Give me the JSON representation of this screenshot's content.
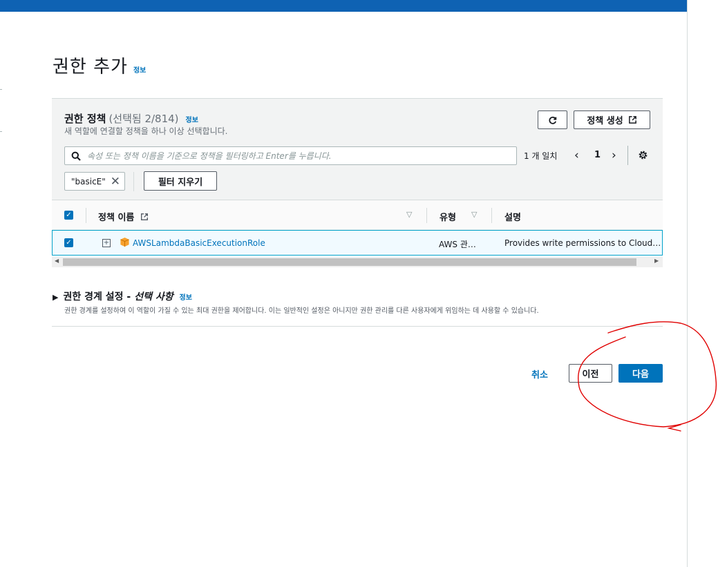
{
  "page": {
    "title": "권한 추가",
    "info_label": "정보"
  },
  "policies_panel": {
    "title": "권한 정책",
    "selection_count": "(선택됨 2/814)",
    "info_label": "정보",
    "description": "새 역할에 연결할 정책을 하나 이상 선택합니다.",
    "create_policy_label": "정책 생성",
    "search_placeholder": "속성 또는 정책 이름을 기준으로 정책을 필터링하고 Enter를 누릅니다.",
    "match_count": "1 개 일치",
    "current_page": "1",
    "filter_token": "\"basicE\"",
    "clear_filters_label": "필터 지우기"
  },
  "table": {
    "columns": [
      "정책 이름",
      "유형",
      "설명"
    ],
    "rows": [
      {
        "selected": true,
        "name": "AWSLambdaBasicExecutionRole",
        "type": "AWS 관…",
        "description": "Provides write permissions to CloudWa…"
      }
    ]
  },
  "boundary": {
    "title": "권한 경계 설정 - ",
    "optional": "선택 사항",
    "info_label": "정보",
    "description": "권한 경계를 설정하여 이 역할이 가질 수 있는 최대 권한을 제어합니다. 이는 일반적인 설정은 아니지만 권한 관리를 다른 사용자에게 위임하는 데 사용할 수 있습니다."
  },
  "footer": {
    "cancel_label": "취소",
    "previous_label": "이전",
    "next_label": "다음"
  },
  "colors": {
    "accent": "#0073bb",
    "topbar": "#0f62b3",
    "annotation": "#e00000"
  },
  "icons": [
    "refresh-icon",
    "external-link-icon",
    "search-icon",
    "chevron-left-icon",
    "chevron-right-icon",
    "gear-icon",
    "close-icon",
    "sort-icon",
    "expand-icon",
    "policy-box-icon",
    "triangle-right-icon"
  ]
}
